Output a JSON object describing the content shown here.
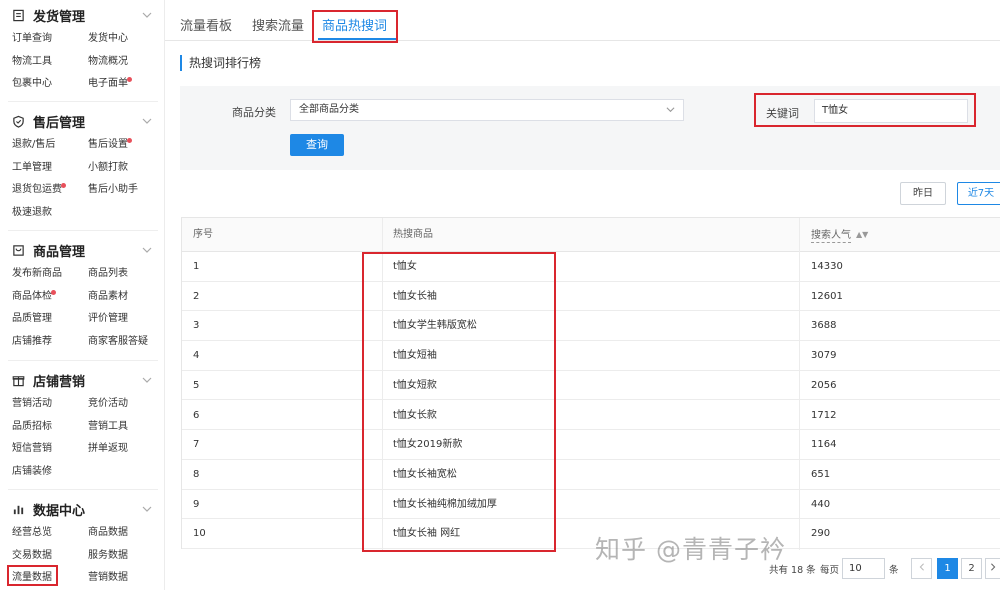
{
  "sidebar": {
    "sections": [
      {
        "title": "发货管理",
        "icon": "document-icon",
        "items": [
          {
            "label": "订单查询",
            "dot": false
          },
          {
            "label": "发货中心",
            "dot": false
          },
          {
            "label": "物流工具",
            "dot": false
          },
          {
            "label": "物流概况",
            "dot": false
          },
          {
            "label": "包裹中心",
            "dot": false
          },
          {
            "label": "电子面单",
            "dot": true
          }
        ]
      },
      {
        "title": "售后管理",
        "icon": "shield-icon",
        "items": [
          {
            "label": "退款/售后",
            "dot": false
          },
          {
            "label": "售后设置",
            "dot": true
          },
          {
            "label": "工单管理",
            "dot": false
          },
          {
            "label": "小额打款",
            "dot": false
          },
          {
            "label": "退货包运费",
            "dot": true
          },
          {
            "label": "售后小助手",
            "dot": false
          },
          {
            "label": "极速退款",
            "dot": false
          }
        ]
      },
      {
        "title": "商品管理",
        "icon": "bag-icon",
        "items": [
          {
            "label": "发布新商品",
            "dot": false
          },
          {
            "label": "商品列表",
            "dot": false
          },
          {
            "label": "商品体检",
            "dot": true
          },
          {
            "label": "商品素材",
            "dot": false
          },
          {
            "label": "品质管理",
            "dot": false
          },
          {
            "label": "评价管理",
            "dot": false
          },
          {
            "label": "店铺推荐",
            "dot": false
          },
          {
            "label": "商家客服答疑",
            "dot": false
          }
        ]
      },
      {
        "title": "店铺营销",
        "icon": "gift-icon",
        "items": [
          {
            "label": "营销活动",
            "dot": false
          },
          {
            "label": "竞价活动",
            "dot": false
          },
          {
            "label": "品质招标",
            "dot": false
          },
          {
            "label": "营销工具",
            "dot": false
          },
          {
            "label": "短信营销",
            "dot": false
          },
          {
            "label": "拼单返现",
            "dot": false
          },
          {
            "label": "店铺装修",
            "dot": false
          }
        ]
      },
      {
        "title": "数据中心",
        "icon": "bar-chart-icon",
        "items": [
          {
            "label": "经营总览",
            "dot": false
          },
          {
            "label": "商品数据",
            "dot": false
          },
          {
            "label": "交易数据",
            "dot": false
          },
          {
            "label": "服务数据",
            "dot": false
          },
          {
            "label": "流量数据",
            "dot": false,
            "active": true
          },
          {
            "label": "营销数据",
            "dot": false
          }
        ]
      }
    ]
  },
  "tabs": [
    {
      "label": "流量看板"
    },
    {
      "label": "搜索流量"
    },
    {
      "label": "商品热搜词",
      "active": true
    }
  ],
  "section_title": "热搜词排行榜",
  "filter": {
    "category_label": "商品分类",
    "category_value": "全部商品分类",
    "keyword_label": "关键词",
    "keyword_value": "T恤女",
    "query_button": "查询"
  },
  "date_buttons": [
    {
      "label": "昨日",
      "active": false
    },
    {
      "label": "近7天",
      "active": true
    }
  ],
  "table": {
    "headers": {
      "index": "序号",
      "product": "热搜商品",
      "popularity": "搜索人气"
    },
    "rows": [
      {
        "index": "1",
        "product": "t恤女",
        "popularity": "14330"
      },
      {
        "index": "2",
        "product": "t恤女长袖",
        "popularity": "12601"
      },
      {
        "index": "3",
        "product": "t恤女学生韩版宽松",
        "popularity": "3688"
      },
      {
        "index": "4",
        "product": "t恤女短袖",
        "popularity": "3079"
      },
      {
        "index": "5",
        "product": "t恤女短款",
        "popularity": "2056"
      },
      {
        "index": "6",
        "product": "t恤女长款",
        "popularity": "1712"
      },
      {
        "index": "7",
        "product": "t恤女2019新款",
        "popularity": "1164"
      },
      {
        "index": "8",
        "product": "t恤女长袖宽松",
        "popularity": "651"
      },
      {
        "index": "9",
        "product": "t恤女长袖纯棉加绒加厚",
        "popularity": "440"
      },
      {
        "index": "10",
        "product": "t恤女长袖 网红",
        "popularity": "290"
      }
    ]
  },
  "pagination": {
    "total_prefix": "共有",
    "total": "18",
    "total_suffix": "条",
    "per_page_label": "每页",
    "per_page": "10",
    "per_page_suffix": "条",
    "pages": [
      "1",
      "2"
    ],
    "current": "1"
  },
  "watermark": "知乎 @青青子衿",
  "colors": {
    "accent": "#1e88e5",
    "highlight": "#d9262e",
    "dot": "#e8505b"
  }
}
